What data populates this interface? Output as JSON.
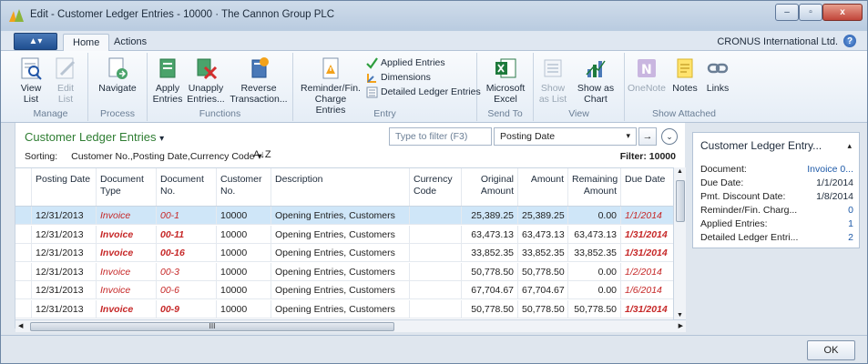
{
  "window": {
    "title": "Edit - Customer Ledger Entries - 10000 · The Cannon Group PLC",
    "minimize": "–",
    "restore": "▫",
    "close": "x"
  },
  "menu": {
    "app_button": "▲▾",
    "tabs": [
      "Home",
      "Actions"
    ],
    "company": "CRONUS International Ltd.",
    "help": "?"
  },
  "ribbon": {
    "groups": {
      "manage": "Manage",
      "process": "Process",
      "functions": "Functions",
      "entry": "Entry",
      "send_to": "Send To",
      "view": "View",
      "show_attached": "Show Attached"
    },
    "buttons": {
      "view_list": [
        "View",
        "List"
      ],
      "edit_list": [
        "Edit",
        "List"
      ],
      "navigate": [
        "Navigate"
      ],
      "apply_entries": [
        "Apply",
        "Entries"
      ],
      "unapply_entries": [
        "Unapply",
        "Entries..."
      ],
      "reverse_transaction": [
        "Reverse",
        "Transaction..."
      ],
      "reminder": [
        "Reminder/Fin.",
        "Charge Entries"
      ],
      "excel": [
        "Microsoft",
        "Excel"
      ],
      "show_as_list": [
        "Show",
        "as List"
      ],
      "show_as_chart": [
        "Show as",
        "Chart"
      ],
      "onenote": [
        "OneNote"
      ],
      "notes": [
        "Notes"
      ],
      "links": [
        "Links"
      ]
    },
    "entry_links": [
      "Applied Entries",
      "Dimensions",
      "Detailed Ledger Entries"
    ]
  },
  "list": {
    "title": "Customer Ledger Entries",
    "title_chevron": "▾",
    "filter_placeholder": "Type to filter (F3)",
    "filter_field": "Posting Date",
    "filter_chevron": "▾",
    "go": "→",
    "expand": "⌄",
    "sorting_label": "Sorting:",
    "sorting_value": "Customer No.,Posting Date,Currency Code ▾",
    "sort_icon": "A↓Z",
    "filter_info": "Filter: 10000",
    "columns": [
      "Posting Date",
      "Document Type",
      "Document No.",
      "Customer No.",
      "Description",
      "Currency Code",
      "Original Amount",
      "Amount",
      "Remaining Amount",
      "Due Date"
    ],
    "rows": [
      {
        "posting_date": "12/31/2013",
        "doc_type": "Invoice",
        "doc_no": "00-1",
        "customer_no": "10000",
        "description": "Opening Entries, Customers",
        "currency": "",
        "original": "25,389.25",
        "amount": "25,389.25",
        "remaining": "0.00",
        "due_date": "1/1/2014",
        "bold": false,
        "selected": true
      },
      {
        "posting_date": "12/31/2013",
        "doc_type": "Invoice",
        "doc_no": "00-11",
        "customer_no": "10000",
        "description": "Opening Entries, Customers",
        "currency": "",
        "original": "63,473.13",
        "amount": "63,473.13",
        "remaining": "63,473.13",
        "due_date": "1/31/2014",
        "bold": true,
        "selected": false
      },
      {
        "posting_date": "12/31/2013",
        "doc_type": "Invoice",
        "doc_no": "00-16",
        "customer_no": "10000",
        "description": "Opening Entries, Customers",
        "currency": "",
        "original": "33,852.35",
        "amount": "33,852.35",
        "remaining": "33,852.35",
        "due_date": "1/31/2014",
        "bold": true,
        "selected": false
      },
      {
        "posting_date": "12/31/2013",
        "doc_type": "Invoice",
        "doc_no": "00-3",
        "customer_no": "10000",
        "description": "Opening Entries, Customers",
        "currency": "",
        "original": "50,778.50",
        "amount": "50,778.50",
        "remaining": "0.00",
        "due_date": "1/2/2014",
        "bold": false,
        "selected": false
      },
      {
        "posting_date": "12/31/2013",
        "doc_type": "Invoice",
        "doc_no": "00-6",
        "customer_no": "10000",
        "description": "Opening Entries, Customers",
        "currency": "",
        "original": "67,704.67",
        "amount": "67,704.67",
        "remaining": "0.00",
        "due_date": "1/6/2014",
        "bold": false,
        "selected": false
      },
      {
        "posting_date": "12/31/2013",
        "doc_type": "Invoice",
        "doc_no": "00-9",
        "customer_no": "10000",
        "description": "Opening Entries, Customers",
        "currency": "",
        "original": "50,778.50",
        "amount": "50,778.50",
        "remaining": "50,778.50",
        "due_date": "1/31/2014",
        "bold": true,
        "selected": false
      }
    ],
    "hscroll_grip": "III"
  },
  "factbox": {
    "title": "Customer Ledger Entry...",
    "collapse": "▴",
    "fields": [
      {
        "label": "Document:",
        "value": "Invoice 0...",
        "link": true
      },
      {
        "label": "Due Date:",
        "value": "1/1/2014",
        "link": false
      },
      {
        "label": "Pmt. Discount Date:",
        "value": "1/8/2014",
        "link": false
      },
      {
        "label": "Reminder/Fin. Charg...",
        "value": "0",
        "link": true
      },
      {
        "label": "Applied Entries:",
        "value": "1",
        "link": true
      },
      {
        "label": "Detailed Ledger Entri...",
        "value": "2",
        "link": true
      }
    ]
  },
  "footer": {
    "ok": "OK"
  },
  "colors": {
    "accent_green": "#2e7d32",
    "invoice_red": "#c62828",
    "selected_row": "#cfe6f8",
    "link_blue": "#1e5aa8"
  }
}
